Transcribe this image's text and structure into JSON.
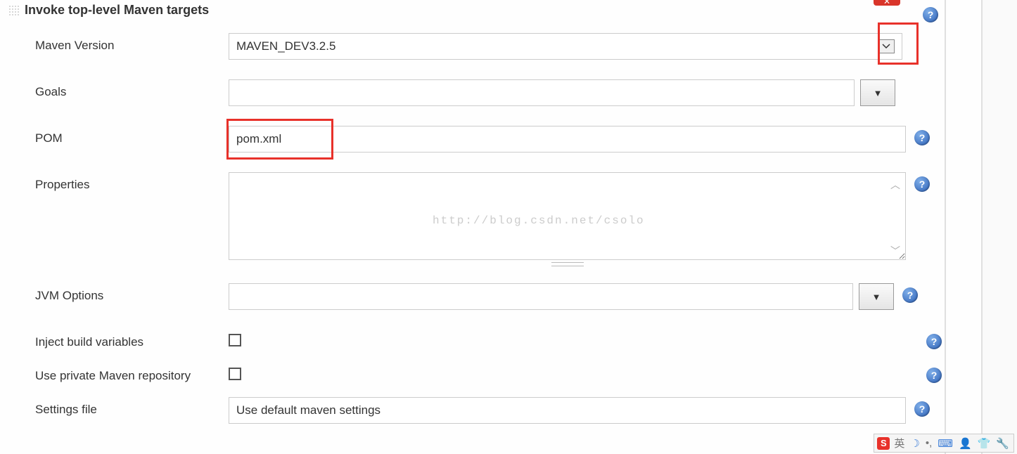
{
  "section": {
    "title": "Invoke top-level Maven targets"
  },
  "fields": {
    "maven_version": {
      "label": "Maven Version",
      "value": "MAVEN_DEV3.2.5"
    },
    "goals": {
      "label": "Goals",
      "value": ""
    },
    "pom": {
      "label": "POM",
      "value": "pom.xml"
    },
    "properties": {
      "label": "Properties",
      "value": ""
    },
    "jvm_options": {
      "label": "JVM Options",
      "value": ""
    },
    "inject_build_vars": {
      "label": "Inject build variables",
      "checked": false
    },
    "use_private_repo": {
      "label": "Use private Maven repository",
      "checked": false
    },
    "settings_file": {
      "label": "Settings file",
      "value": "Use default maven settings"
    }
  },
  "watermark": "http://blog.csdn.net/csolo",
  "taskbar": {
    "ime_badge": "S",
    "lang": "英"
  }
}
